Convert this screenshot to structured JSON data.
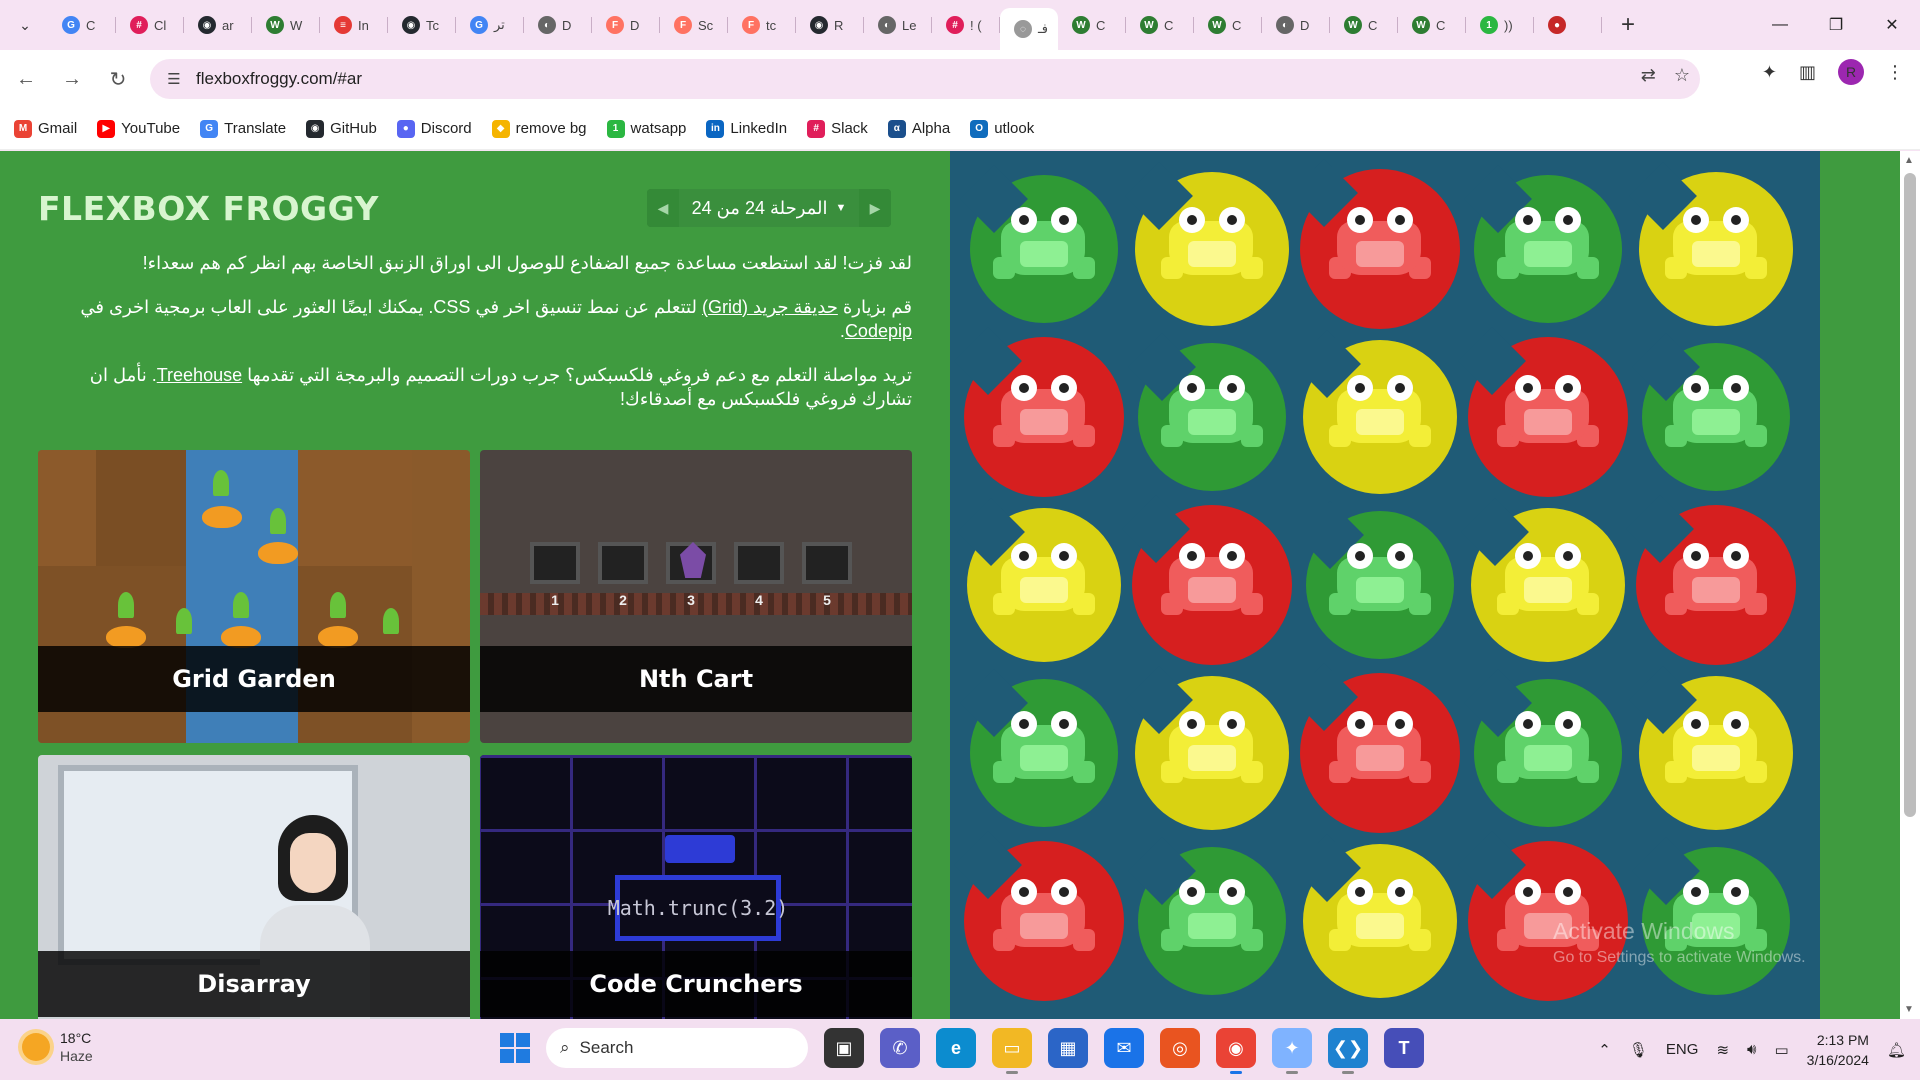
{
  "browser": {
    "tabs": [
      {
        "label": "C",
        "color": "#4285f4",
        "glyph": "G"
      },
      {
        "label": "Cl",
        "color": "#e01e5a",
        "glyph": "#"
      },
      {
        "label": "ar",
        "color": "#24292f",
        "glyph": "◉"
      },
      {
        "label": "W",
        "color": "#2e7d32",
        "glyph": "W"
      },
      {
        "label": "In",
        "color": "#e53935",
        "glyph": "≡"
      },
      {
        "label": "Tc",
        "color": "#24292f",
        "glyph": "◉"
      },
      {
        "label": "تر",
        "color": "#4285f4",
        "glyph": "G"
      },
      {
        "label": "D",
        "color": "#666666",
        "glyph": "◐"
      },
      {
        "label": "D",
        "color": "#ff7262",
        "glyph": "F"
      },
      {
        "label": "Sc",
        "color": "#ff7262",
        "glyph": "F"
      },
      {
        "label": "tc",
        "color": "#ff7262",
        "glyph": "F"
      },
      {
        "label": "R",
        "color": "#24292f",
        "glyph": "◉"
      },
      {
        "label": "Le",
        "color": "#666666",
        "glyph": "◐"
      },
      {
        "label": "! (",
        "color": "#e01e5a",
        "glyph": "#"
      },
      {
        "label": "فـ",
        "color": "#999999",
        "glyph": "◌",
        "active": true
      },
      {
        "label": "C",
        "color": "#2e7d32",
        "glyph": "W"
      },
      {
        "label": "C",
        "color": "#2e7d32",
        "glyph": "W"
      },
      {
        "label": "C",
        "color": "#2e7d32",
        "glyph": "W"
      },
      {
        "label": "D",
        "color": "#666666",
        "glyph": "◐"
      },
      {
        "label": "C",
        "color": "#2e7d32",
        "glyph": "W"
      },
      {
        "label": "C",
        "color": "#2e7d32",
        "glyph": "W"
      },
      {
        "label": "))",
        "color": "#2bb741",
        "glyph": "1"
      },
      {
        "label": "",
        "color": "#c62828",
        "glyph": "●"
      }
    ],
    "url": "flexboxfroggy.com/#ar",
    "bookmarks": [
      {
        "label": "Gmail",
        "color": "#ea4335",
        "glyph": "M"
      },
      {
        "label": "YouTube",
        "color": "#ff0000",
        "glyph": "▶"
      },
      {
        "label": "Translate",
        "color": "#4285f4",
        "glyph": "G"
      },
      {
        "label": "GitHub",
        "color": "#24292f",
        "glyph": "◉"
      },
      {
        "label": "Discord",
        "color": "#5865f2",
        "glyph": "●"
      },
      {
        "label": "remove bg",
        "color": "#f5b400",
        "glyph": "◆"
      },
      {
        "label": "watsapp",
        "color": "#2bb741",
        "glyph": "1"
      },
      {
        "label": "LinkedIn",
        "color": "#0a66c2",
        "glyph": "in"
      },
      {
        "label": "Slack",
        "color": "#e01e5a",
        "glyph": "#"
      },
      {
        "label": "Alpha",
        "color": "#1b4f8c",
        "glyph": "α"
      },
      {
        "label": "utlook",
        "color": "#0f6cbd",
        "glyph": "O"
      }
    ],
    "profile_initial": "R"
  },
  "game": {
    "logo": "FLEXBOX FROGGY",
    "level_indicator": "المرحلة 24 من 24",
    "win_message": "لقد فزت! لقد استطعت مساعدة جميع الضفادع للوصول الى اوراق الزنبق الخاصة بهم انظر كم هم سعداء!",
    "p2_before": "قم بزيارة ",
    "p2_link1": "حديقة جريد (Grid)",
    "p2_middle": " لتتعلم عن نمط تنسيق اخر في CSS. يمكنك ايضًا العثور على العاب برمجية اخرى في ",
    "p2_link2": "Codepip",
    "p2_after": ".",
    "p3_before": "تريد مواصلة التعلم مع دعم فروغي فلكسبكس؟ جرب دورات التصميم والبرمجة التي تقدمها ",
    "p3_link": "Treehouse",
    "p3_after": ". نأمل ان تشارك فروغي فلكسبكس مع أصدقاءك!",
    "cards": [
      {
        "label": "Grid Garden"
      },
      {
        "label": "Nth Cart",
        "cart_numbers": [
          "1",
          "2",
          "3",
          "4",
          "5"
        ]
      },
      {
        "label": "Disarray"
      },
      {
        "label": "Code Crunchers",
        "code": "Math.trunc(3.2)"
      }
    ],
    "board": [
      [
        "green",
        "yellow",
        "red",
        "green",
        "yellow"
      ],
      [
        "red",
        "green",
        "yellow",
        "red",
        "green"
      ],
      [
        "yellow",
        "red",
        "green",
        "yellow",
        "red"
      ],
      [
        "green",
        "yellow",
        "red",
        "green",
        "yellow"
      ],
      [
        "red",
        "green",
        "yellow",
        "red",
        "green"
      ]
    ],
    "colors": {
      "green": {
        "pad": "#2f9a35",
        "frog": "#5fd26a",
        "belly": "#8ef093"
      },
      "yellow": {
        "pad": "#d9d212",
        "frog": "#f3ee37",
        "belly": "#fbf98e"
      },
      "red": {
        "pad": "#d61f1f",
        "frog": "#f05c5c",
        "belly": "#f79a9a"
      }
    }
  },
  "watermark": {
    "line1": "Activate Windows",
    "line2": "Go to Settings to activate Windows."
  },
  "taskbar": {
    "temperature": "18°C",
    "condition": "Haze",
    "search_label": "Search",
    "language": "ENG",
    "time": "2:13 PM",
    "date": "3/16/2024"
  }
}
